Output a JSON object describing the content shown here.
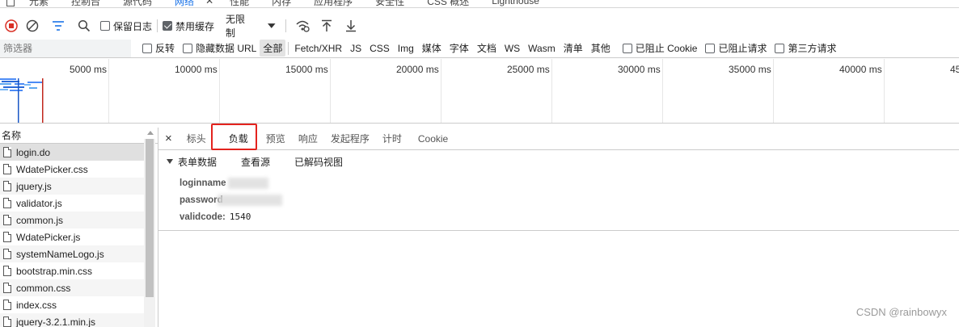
{
  "top_tabs": [
    {
      "label": "元素"
    },
    {
      "label": "控制台"
    },
    {
      "label": "源代码"
    },
    {
      "label": "网络"
    },
    {
      "label": "性能"
    },
    {
      "label": "内存"
    },
    {
      "label": "应用程序"
    },
    {
      "label": "安全性"
    },
    {
      "label": "CSS 概述"
    },
    {
      "label": "Lighthouse"
    }
  ],
  "toolbar": {
    "preserve_log": "保留日志",
    "disable_cache": "禁用缓存",
    "throttling": "无限制"
  },
  "filter": {
    "placeholder": "筛选器",
    "invert": "反转",
    "hide_data_url": "隐藏数据 URL",
    "types": [
      "全部",
      "Fetch/XHR",
      "JS",
      "CSS",
      "Img",
      "媒体",
      "字体",
      "文档",
      "WS",
      "Wasm",
      "清单",
      "其他"
    ],
    "blocked_cookies": "已阻止 Cookie",
    "blocked_requests": "已阻止请求",
    "third_party": "第三方请求"
  },
  "timeline": {
    "ticks": [
      "5000 ms",
      "10000 ms",
      "15000 ms",
      "20000 ms",
      "25000 ms",
      "30000 ms",
      "35000 ms",
      "40000 ms",
      "45"
    ]
  },
  "requests": {
    "header": "名称",
    "items": [
      {
        "name": "login.do"
      },
      {
        "name": "WdatePicker.css"
      },
      {
        "name": "jquery.js"
      },
      {
        "name": "validator.js"
      },
      {
        "name": "common.js"
      },
      {
        "name": "WdatePicker.js"
      },
      {
        "name": "systemNameLogo.js"
      },
      {
        "name": "bootstrap.min.css"
      },
      {
        "name": "common.css"
      },
      {
        "name": "index.css"
      },
      {
        "name": "jquery-3.2.1.min.js"
      }
    ]
  },
  "detail": {
    "close": "×",
    "tabs": [
      {
        "label": "标头"
      },
      {
        "label": "负载"
      },
      {
        "label": "预览"
      },
      {
        "label": "响应"
      },
      {
        "label": "发起程序"
      },
      {
        "label": "计时"
      },
      {
        "label": "Cookie"
      }
    ],
    "section_title": "表单数据",
    "view_source": "查看源",
    "view_decoded": "已解码视图",
    "fields": [
      {
        "key": "loginname",
        "value": ""
      },
      {
        "key": "password",
        "value": ""
      },
      {
        "key": "validcode:",
        "value": "1540"
      }
    ]
  },
  "watermark": "CSDN @rainbowyx",
  "colors": {
    "accent": "#1a73e8",
    "highlight_box": "#e3231e",
    "record_red": "#d93025"
  }
}
